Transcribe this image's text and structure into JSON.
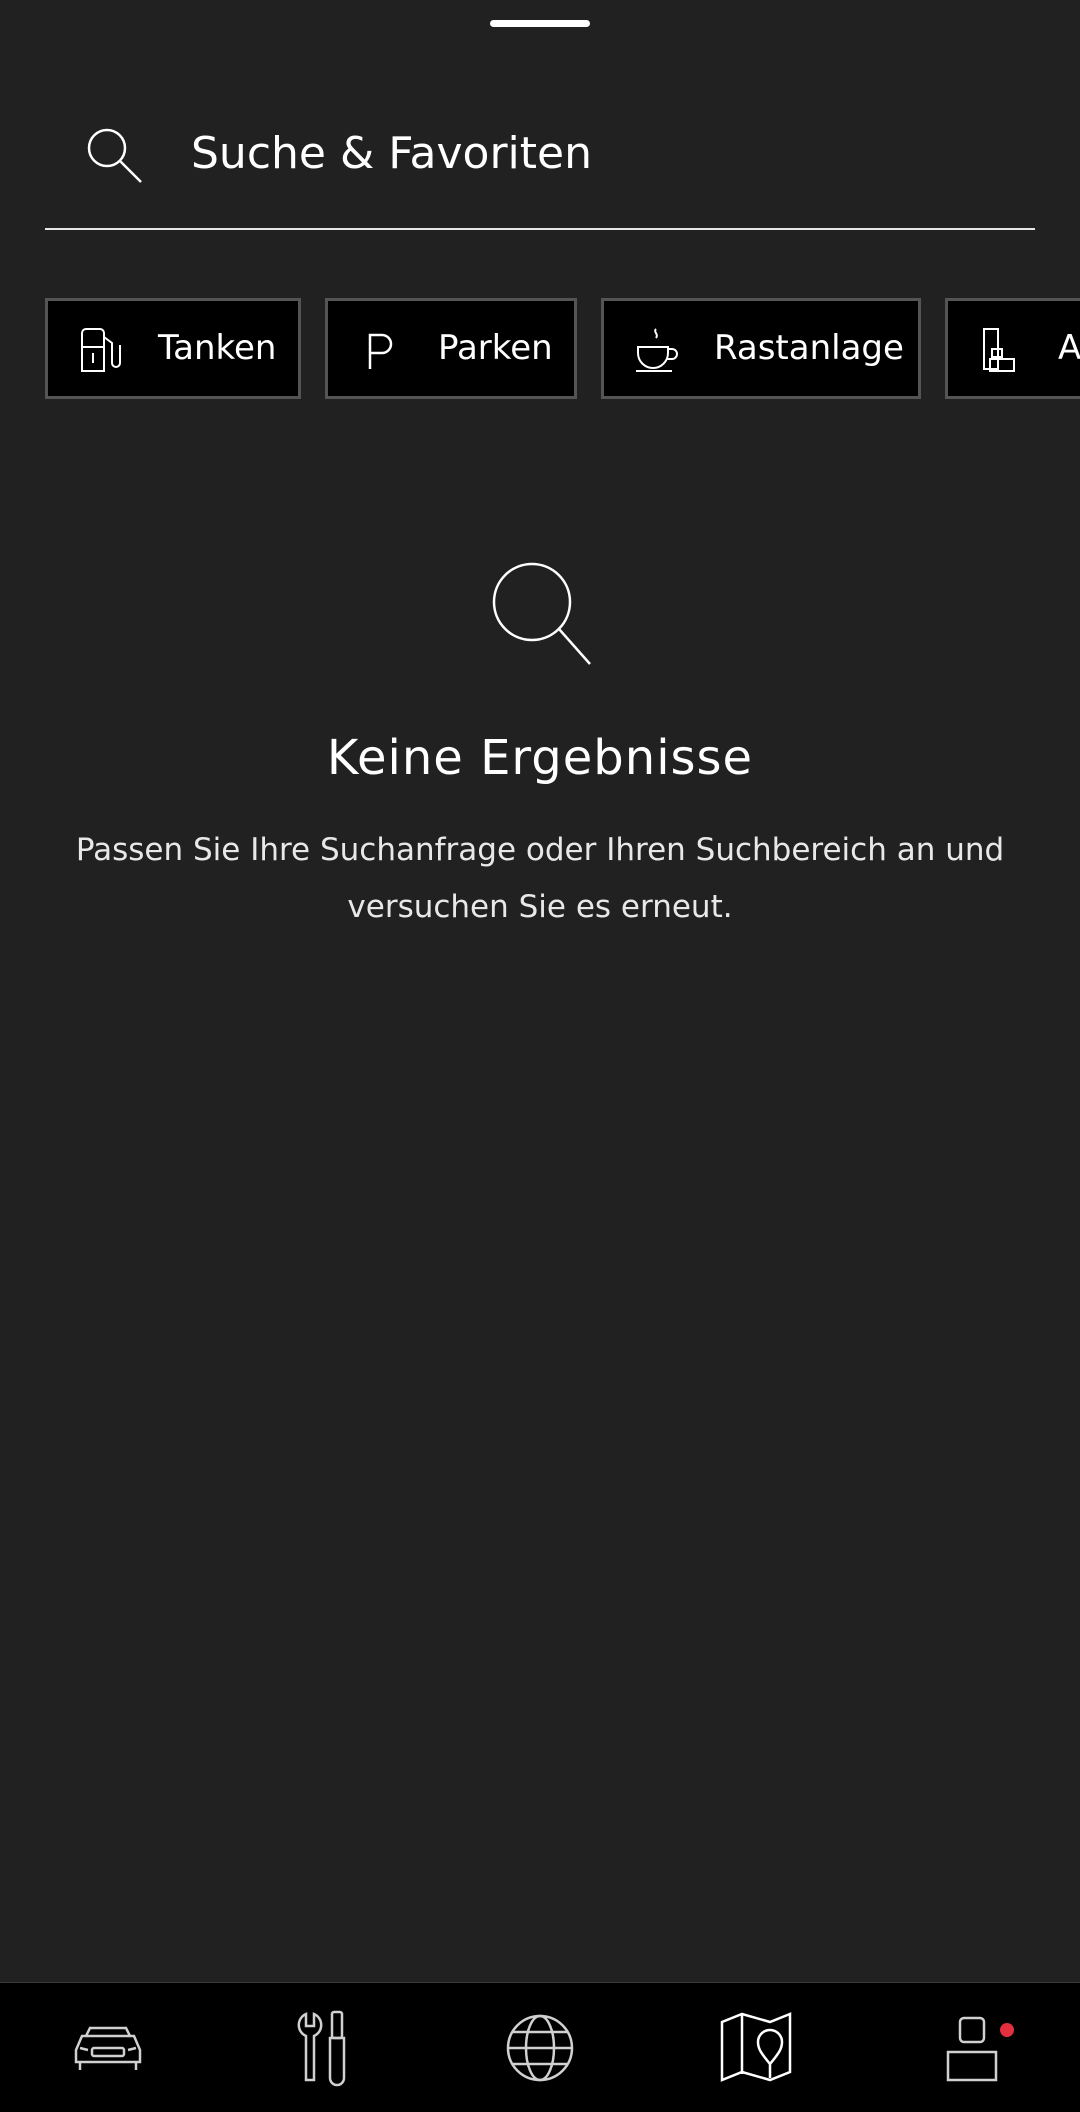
{
  "search": {
    "placeholder": "Suche & Favoriten"
  },
  "chips": [
    {
      "label": "Tanken",
      "icon": "fuel-pump-icon"
    },
    {
      "label": "Parken",
      "icon": "parking-icon"
    },
    {
      "label": "Rastanlage",
      "icon": "coffee-cup-icon"
    },
    {
      "label": "A",
      "icon": "building-icon"
    }
  ],
  "empty_state": {
    "title": "Keine Ergebnisse",
    "description": "Passen Sie Ihre Suchanfrage oder Ihren Suchbereich an und versuchen Sie es erneut."
  },
  "bottom_nav": {
    "items": [
      {
        "icon": "car-icon"
      },
      {
        "icon": "tools-icon"
      },
      {
        "icon": "globe-icon"
      },
      {
        "icon": "map-icon"
      },
      {
        "icon": "profile-icon",
        "has_notification": true
      }
    ]
  },
  "colors": {
    "background": "#212121",
    "chip_background": "#000000",
    "chip_border": "#545454",
    "nav_background": "#000000",
    "notification": "#e3303f"
  }
}
